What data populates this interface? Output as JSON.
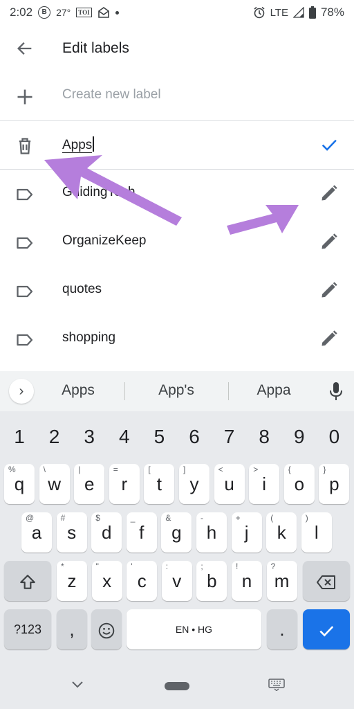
{
  "status_bar": {
    "time": "2:02",
    "b_badge": "B",
    "temperature": "27°",
    "toi": "TOI",
    "network": "LTE",
    "battery": "78%"
  },
  "app_bar": {
    "title": "Edit labels"
  },
  "create_row": {
    "placeholder": "Create new label"
  },
  "editing_row": {
    "value": "Apps"
  },
  "labels": [
    {
      "name": "GuidingTech"
    },
    {
      "name": "OrganizeKeep"
    },
    {
      "name": "quotes"
    },
    {
      "name": "shopping"
    }
  ],
  "keyboard": {
    "suggestions": [
      "Apps",
      "App's",
      "Appa"
    ],
    "number_row": [
      "1",
      "2",
      "3",
      "4",
      "5",
      "6",
      "7",
      "8",
      "9",
      "0"
    ],
    "row1": [
      {
        "k": "q",
        "h": "%"
      },
      {
        "k": "w",
        "h": "\\"
      },
      {
        "k": "e",
        "h": "|"
      },
      {
        "k": "r",
        "h": "="
      },
      {
        "k": "t",
        "h": "["
      },
      {
        "k": "y",
        "h": "]"
      },
      {
        "k": "u",
        "h": "<"
      },
      {
        "k": "i",
        "h": ">"
      },
      {
        "k": "o",
        "h": "{"
      },
      {
        "k": "p",
        "h": "}"
      }
    ],
    "row2": [
      {
        "k": "a",
        "h": "@"
      },
      {
        "k": "s",
        "h": "#"
      },
      {
        "k": "d",
        "h": "$"
      },
      {
        "k": "f",
        "h": "_"
      },
      {
        "k": "g",
        "h": "&"
      },
      {
        "k": "h",
        "h": "-"
      },
      {
        "k": "j",
        "h": "+"
      },
      {
        "k": "k",
        "h": "("
      },
      {
        "k": "l",
        "h": ")"
      }
    ],
    "row3": [
      {
        "k": "z",
        "h": "*"
      },
      {
        "k": "x",
        "h": "\""
      },
      {
        "k": "c",
        "h": "'"
      },
      {
        "k": "v",
        "h": ":"
      },
      {
        "k": "b",
        "h": ";"
      },
      {
        "k": "n",
        "h": "!"
      },
      {
        "k": "m",
        "h": "?"
      }
    ],
    "symbols_key": "?123",
    "comma": ",",
    "space_label": "EN • HG",
    "period": "."
  },
  "colors": {
    "accent": "#1a73e8",
    "arrow": "#b57edc",
    "check": "#1a73e8"
  }
}
